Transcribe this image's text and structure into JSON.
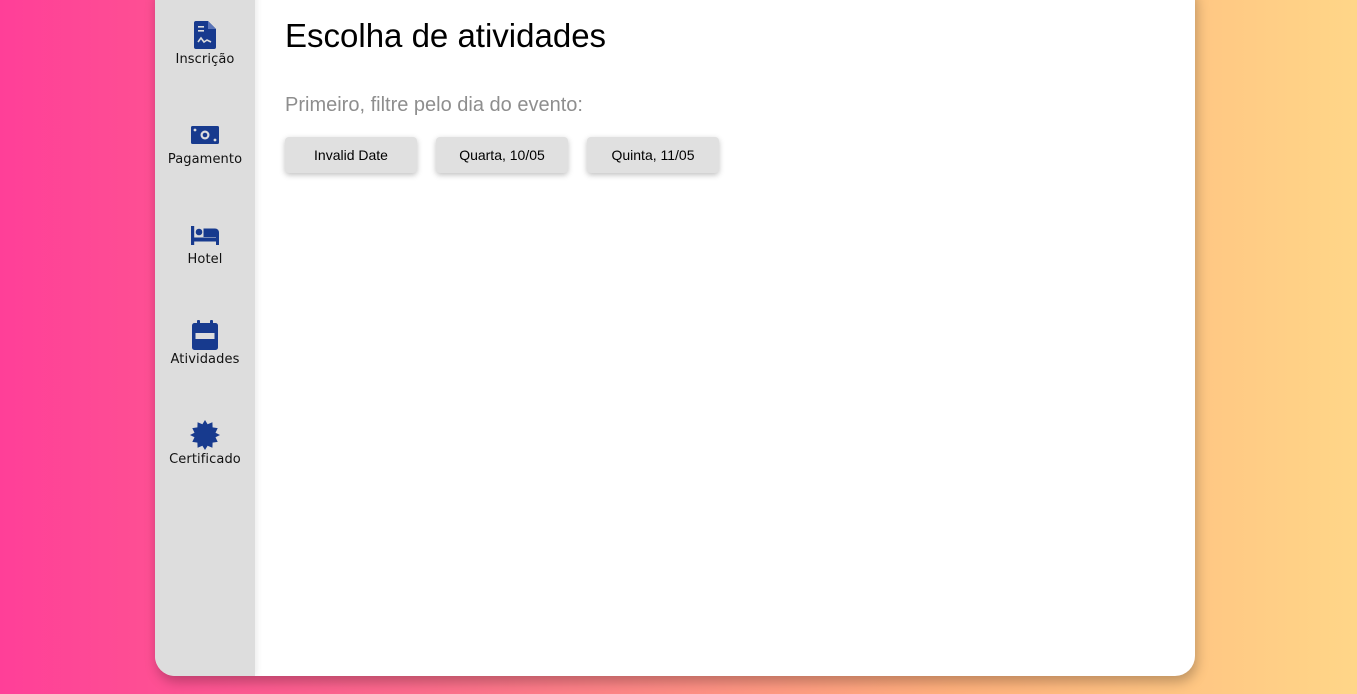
{
  "colors": {
    "accent_icon": "#173a8e",
    "sidebar_bg": "#dddddd",
    "button_bg": "#e0e0e0",
    "gradient_start": "#ff3f98",
    "gradient_end": "#ffd688"
  },
  "sidebar": {
    "items": [
      {
        "label": "Inscrição",
        "icon": "document-icon"
      },
      {
        "label": "Pagamento",
        "icon": "money-bill-icon"
      },
      {
        "label": "Hotel",
        "icon": "bed-icon"
      },
      {
        "label": "Atividades",
        "icon": "calendar-icon"
      },
      {
        "label": "Certificado",
        "icon": "certificate-badge-icon"
      }
    ]
  },
  "main": {
    "title": "Escolha de atividades",
    "subtitle": "Primeiro, filtre pelo dia do evento:",
    "day_buttons": [
      {
        "label": "Invalid Date"
      },
      {
        "label": "Quarta, 10/05"
      },
      {
        "label": "Quinta, 11/05"
      }
    ]
  }
}
